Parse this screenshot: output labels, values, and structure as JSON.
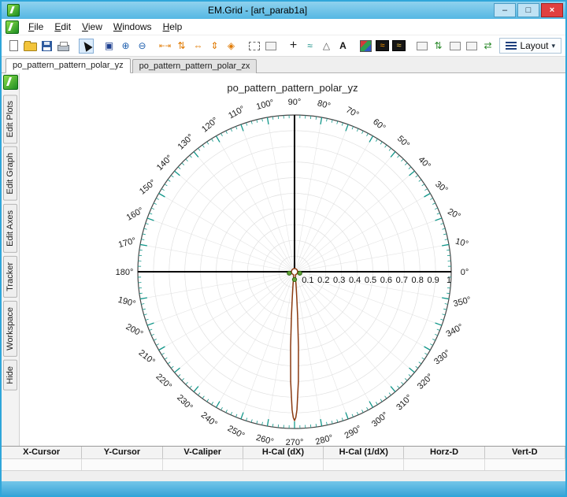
{
  "window": {
    "title": "EM.Grid - [art_parab1a]",
    "controls": {
      "minimize": "–",
      "maximize": "□",
      "close": "×"
    }
  },
  "menu": {
    "items": [
      {
        "key": "F",
        "rest": "ile"
      },
      {
        "key": "E",
        "rest": "dit"
      },
      {
        "key": "V",
        "rest": "iew"
      },
      {
        "key": "W",
        "rest": "indows"
      },
      {
        "key": "H",
        "rest": "elp"
      }
    ]
  },
  "toolbar": {
    "layout_label": "Layout",
    "layout_caret": "▾",
    "items": [
      {
        "name": "new-document",
        "type": "page"
      },
      {
        "name": "open-file",
        "type": "folder"
      },
      {
        "name": "save-file",
        "type": "floppy"
      },
      {
        "name": "print",
        "type": "printer"
      },
      {
        "name": "select-cursor",
        "type": "cursor",
        "pressed": true,
        "gap": true
      },
      {
        "name": "zoom-window",
        "type": "glyph",
        "glyph": "▣",
        "fg": "#1d3f8f",
        "gap": true
      },
      {
        "name": "zoom-in",
        "type": "glyph",
        "glyph": "⊕",
        "fg": "#1f5fae"
      },
      {
        "name": "zoom-out",
        "type": "glyph",
        "glyph": "⊖",
        "fg": "#1f5fae"
      },
      {
        "name": "fit-width",
        "type": "glyph",
        "glyph": "⇤⇥",
        "fg": "#e07900",
        "small": true,
        "gap": true
      },
      {
        "name": "fit-height",
        "type": "glyph",
        "glyph": "⇅",
        "fg": "#e07900"
      },
      {
        "name": "expand-horizontal",
        "type": "glyph",
        "glyph": "⇔",
        "fg": "#e07900"
      },
      {
        "name": "expand-vertical",
        "type": "glyph",
        "glyph": "⇕",
        "fg": "#e07900"
      },
      {
        "name": "fit-all",
        "type": "glyph",
        "glyph": "◈",
        "fg": "#e07900"
      },
      {
        "name": "marquee-select",
        "type": "dashedbox",
        "gap": true
      },
      {
        "name": "region-zoom",
        "type": "box"
      },
      {
        "name": "add-cursor",
        "type": "glyph",
        "glyph": "+",
        "fg": "#222",
        "big": true,
        "gap": true
      },
      {
        "name": "curve-tracker",
        "type": "glyph",
        "glyph": "≈",
        "fg": "#0c8a80"
      },
      {
        "name": "delta-marker",
        "type": "glyph",
        "glyph": "△",
        "fg": "#555"
      },
      {
        "name": "text-annotation",
        "type": "glyph",
        "glyph": "A",
        "fg": "#111",
        "bold": true
      },
      {
        "name": "color-plot",
        "type": "gradientbox",
        "gap": true
      },
      {
        "name": "dark-plot-style-1",
        "type": "darkwave",
        "fg": "#ff9a00"
      },
      {
        "name": "dark-plot-style-2",
        "type": "darkwave",
        "fg": "#ffd24a"
      },
      {
        "name": "pane-option-1",
        "type": "box",
        "gap": true
      },
      {
        "name": "fit-vertical-green",
        "type": "glyph",
        "glyph": "⇅",
        "fg": "#2c8a2c"
      },
      {
        "name": "pane-option-2",
        "type": "box"
      },
      {
        "name": "pane-option-3",
        "type": "box"
      },
      {
        "name": "fit-horizontal-green",
        "type": "glyph",
        "glyph": "⇄",
        "fg": "#2c8a2c"
      }
    ]
  },
  "tabs": {
    "items": [
      {
        "label": "po_pattern_pattern_polar_yz",
        "active": true
      },
      {
        "label": "po_pattern_pattern_polar_zx",
        "active": false
      }
    ]
  },
  "sidebar": {
    "tabs": [
      "Edit Plots",
      "Edit Graph",
      "Edit Axes",
      "Tracker",
      "Workspace",
      "Hide"
    ]
  },
  "status": {
    "columns": [
      "X-Cursor",
      "Y-Cursor",
      "V-Caliper",
      "H-Cal (dX)",
      "H-Cal (1/dX)",
      "Horz-D",
      "Vert-D"
    ]
  },
  "chart_data": {
    "type": "polar",
    "title": "po_pattern_pattern_polar_yz",
    "angle_step_deg": 10,
    "angle_labels": [
      "0°",
      "10°",
      "20°",
      "30°",
      "40°",
      "50°",
      "60°",
      "70°",
      "80°",
      "90°",
      "100°",
      "110°",
      "120°",
      "130°",
      "140°",
      "150°",
      "160°",
      "170°",
      "180°",
      "190°",
      "200°",
      "210°",
      "220°",
      "230°",
      "240°",
      "250°",
      "260°",
      "270°",
      "280°",
      "290°",
      "300°",
      "310°",
      "320°",
      "330°",
      "340°",
      "350°"
    ],
    "radial_labels": [
      "0.1",
      "0.2",
      "0.3",
      "0.4",
      "0.5",
      "0.6",
      "0.7",
      "0.8",
      "0.9",
      "1"
    ],
    "rlim": [
      0,
      1
    ],
    "main_lobe_direction_deg": 270,
    "main_lobe_peak": 0.95,
    "colors": {
      "grid": "#e0e0e0",
      "spoke": "#e4e4e4",
      "outer": "#474747",
      "tick": "#13978a",
      "axis": "#000000"
    },
    "series": [
      {
        "name": "po_pattern",
        "color": "#8a3a10",
        "points": [
          [
            0,
            0.02
          ],
          [
            20,
            0.02
          ],
          [
            40,
            0.02
          ],
          [
            60,
            0.02
          ],
          [
            80,
            0.02
          ],
          [
            90,
            0.022
          ],
          [
            100,
            0.02
          ],
          [
            120,
            0.02
          ],
          [
            140,
            0.02
          ],
          [
            160,
            0.02
          ],
          [
            180,
            0.02
          ],
          [
            200,
            0.02
          ],
          [
            220,
            0.02
          ],
          [
            240,
            0.02
          ],
          [
            252,
            0.02
          ],
          [
            256,
            0.024
          ],
          [
            258,
            0.028
          ],
          [
            260,
            0.034
          ],
          [
            262,
            0.05
          ],
          [
            263,
            0.07
          ],
          [
            264,
            0.1
          ],
          [
            265,
            0.16
          ],
          [
            266,
            0.28
          ],
          [
            267,
            0.48
          ],
          [
            268,
            0.7
          ],
          [
            269,
            0.88
          ],
          [
            269.5,
            0.93
          ],
          [
            270,
            0.95
          ],
          [
            270.5,
            0.93
          ],
          [
            271,
            0.88
          ],
          [
            272,
            0.7
          ],
          [
            273,
            0.48
          ],
          [
            274,
            0.28
          ],
          [
            275,
            0.16
          ],
          [
            276,
            0.1
          ],
          [
            277,
            0.07
          ],
          [
            278,
            0.05
          ],
          [
            280,
            0.034
          ],
          [
            282,
            0.028
          ],
          [
            284,
            0.024
          ],
          [
            288,
            0.02
          ],
          [
            300,
            0.02
          ],
          [
            320,
            0.02
          ],
          [
            340,
            0.02
          ],
          [
            360,
            0.02
          ]
        ]
      }
    ],
    "markers": {
      "color": "#63a33a",
      "stroke": "#2f6b14",
      "points": [
        [
          195,
          0.035
        ],
        [
          345,
          0.035
        ],
        [
          270,
          0.05
        ]
      ]
    }
  }
}
